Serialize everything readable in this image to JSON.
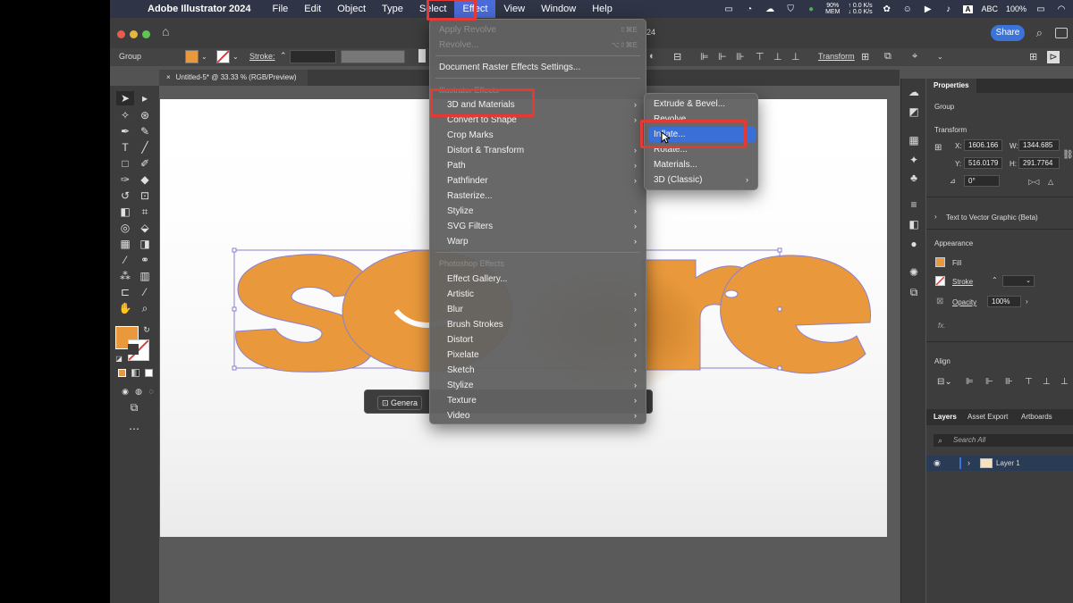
{
  "menubar": {
    "app_name": "Adobe Illustrator 2024",
    "menus": [
      "File",
      "Edit",
      "Object",
      "Type",
      "Select",
      "Effect",
      "View",
      "Window",
      "Help"
    ],
    "active_menu": "Effect",
    "battery_pct_line1": "90%",
    "battery_pct_line2": "MEM",
    "net_up": "↑ 0.0 K/s",
    "net_down": "↓ 0.0 K/s",
    "input_label": "ABC",
    "input_badge": "A",
    "battery": "100%"
  },
  "titlebar": {
    "share": "Share",
    "zoom_partial": "24"
  },
  "controlbar": {
    "selection": "Group",
    "stroke_label": "Stroke:",
    "transform": "Transform"
  },
  "document": {
    "tab": "Untitled-5* @ 33.33 % (RGB/Preview)",
    "generate_label": "Genera"
  },
  "colors": {
    "artwork_fill": "#e9993c",
    "artwork_stroke": "#8b7fd0",
    "menu_highlight": "#e53935",
    "selection_blue": "#3b73d8"
  },
  "effect_menu": {
    "items": [
      {
        "label": "Apply Revolve",
        "shortcut": "⇧⌘E",
        "disabled": true
      },
      {
        "label": "Revolve...",
        "shortcut": "⌥⇧⌘E",
        "disabled": true
      },
      {
        "label": "Document Raster Effects Settings..."
      },
      {
        "label": "Illustrator Effects",
        "header": true
      },
      {
        "label": "3D and Materials",
        "submenu": true,
        "highlighted": true
      },
      {
        "label": "Convert to Shape",
        "submenu": true
      },
      {
        "label": "Crop Marks"
      },
      {
        "label": "Distort & Transform",
        "submenu": true
      },
      {
        "label": "Path",
        "submenu": true
      },
      {
        "label": "Pathfinder",
        "submenu": true
      },
      {
        "label": "Rasterize..."
      },
      {
        "label": "Stylize",
        "submenu": true
      },
      {
        "label": "SVG Filters",
        "submenu": true
      },
      {
        "label": "Warp",
        "submenu": true
      },
      {
        "label": "Photoshop Effects",
        "header": true
      },
      {
        "label": "Effect Gallery..."
      },
      {
        "label": "Artistic",
        "submenu": true
      },
      {
        "label": "Blur",
        "submenu": true
      },
      {
        "label": "Brush Strokes",
        "submenu": true
      },
      {
        "label": "Distort",
        "submenu": true
      },
      {
        "label": "Pixelate",
        "submenu": true
      },
      {
        "label": "Sketch",
        "submenu": true
      },
      {
        "label": "Stylize",
        "submenu": true
      },
      {
        "label": "Texture",
        "submenu": true
      },
      {
        "label": "Video",
        "submenu": true
      }
    ]
  },
  "submenu_3d": {
    "items": [
      {
        "label": "Extrude & Bevel..."
      },
      {
        "label": "Revolve..."
      },
      {
        "label": "Inflate...",
        "selected": true
      },
      {
        "label": "Rotate..."
      },
      {
        "label": "Materials..."
      },
      {
        "label": "3D (Classic)",
        "submenu": true
      }
    ]
  },
  "properties": {
    "tab": "Properties",
    "group": "Group",
    "transform_title": "Transform",
    "x_label": "X:",
    "x": "1606.166",
    "y_label": "Y:",
    "y": "516.0179",
    "w_label": "W:",
    "w": "1344.685",
    "h_label": "H:",
    "h": "291.7764",
    "angle": "0°",
    "text_to_vector": "Text to Vector Graphic (Beta)",
    "appearance": "Appearance",
    "fill": "Fill",
    "stroke": "Stroke",
    "opacity_label": "Opacity",
    "opacity": "100%",
    "fx": "fx.",
    "align": "Align"
  },
  "layers": {
    "tabs": [
      "Layers",
      "Asset Export",
      "Artboards"
    ],
    "search_placeholder": "Search All",
    "layer_name": "Layer 1"
  }
}
